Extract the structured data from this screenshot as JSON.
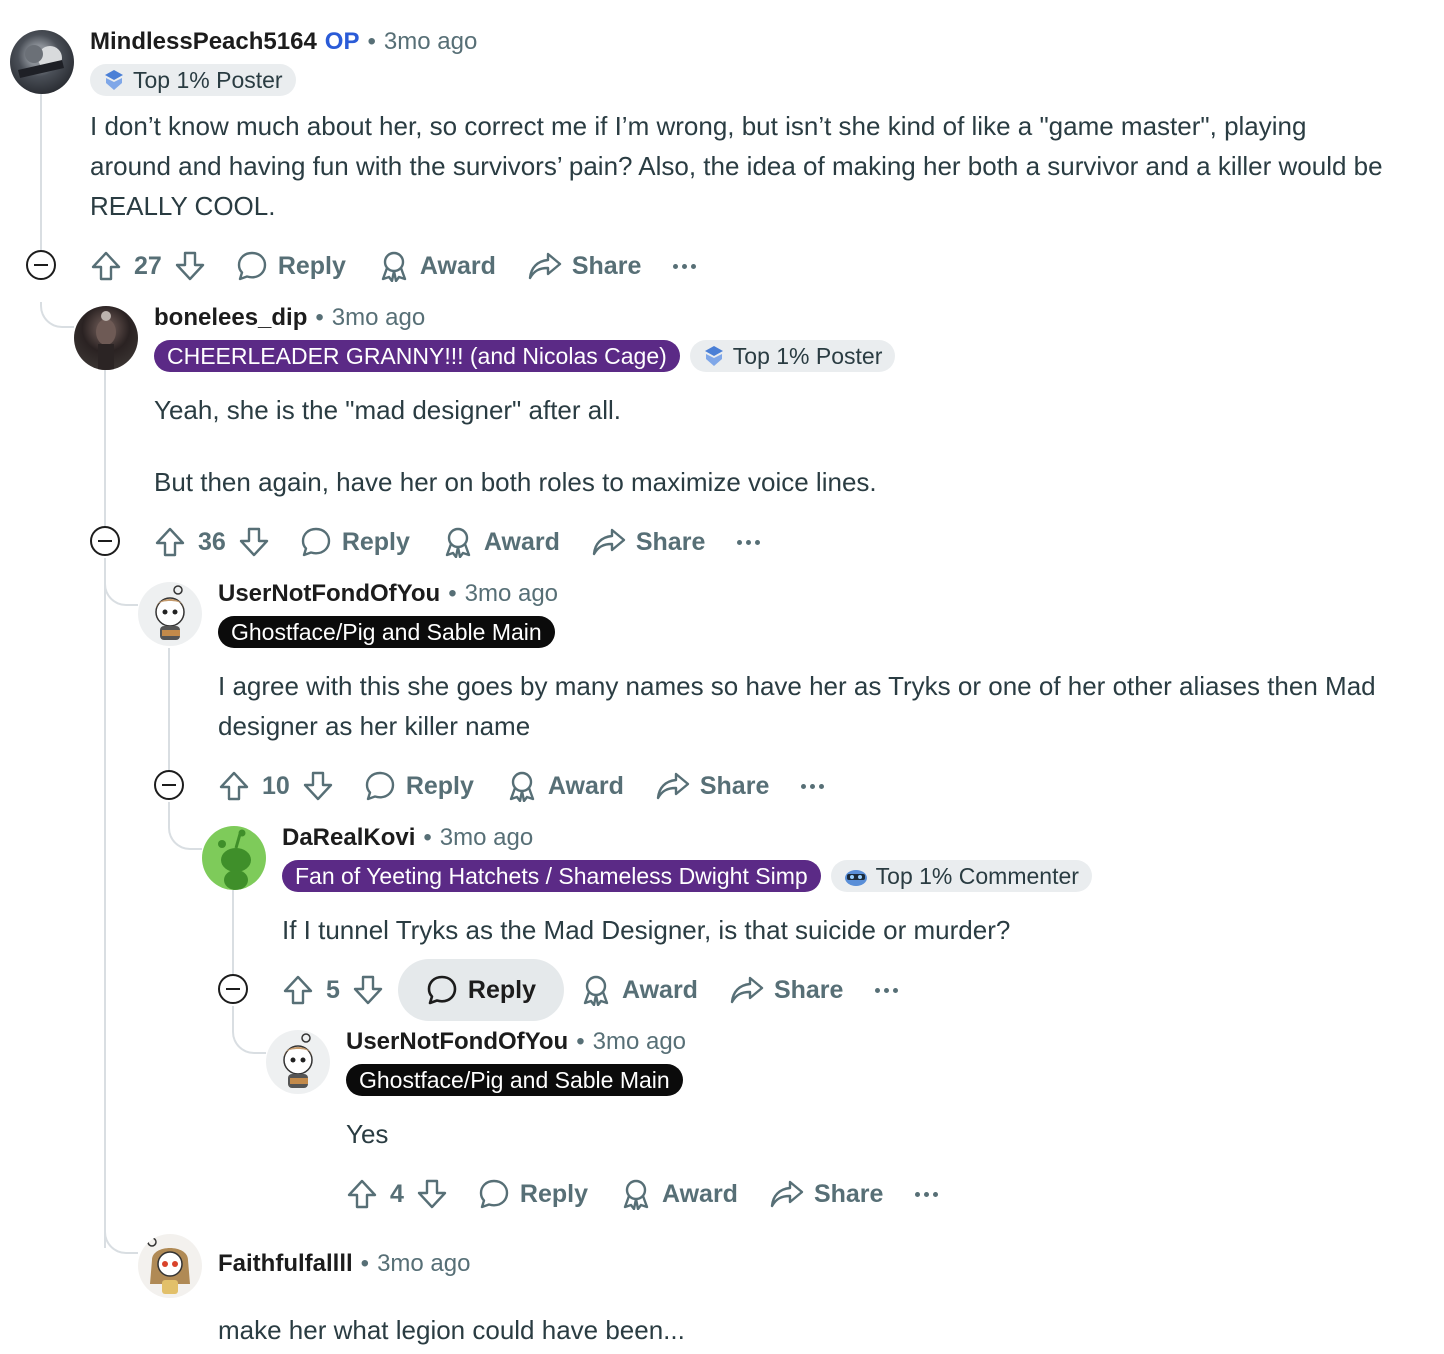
{
  "comments": [
    {
      "username": "MindlessPeach5164",
      "op_label": "OP",
      "time": "3mo ago",
      "flairs": [
        {
          "text": "Top 1% Poster",
          "icon": "top-poster-icon"
        }
      ],
      "body": [
        "I don’t know much about her, so correct me if I’m wrong, but isn’t she kind of like a \"game master\", playing around and having fun with the survivors’ pain? Also, the idea of making her both a survivor and a killer would be REALLY COOL."
      ],
      "score": "27",
      "avatar_icon": "user-avatar-icon"
    },
    {
      "username": "bonelees_dip",
      "time": "3mo ago",
      "flairs": [
        {
          "text": "CHEERLEADER GRANNY!!! (and Nicolas Cage)"
        },
        {
          "text": "Top 1% Poster",
          "icon": "top-poster-icon"
        }
      ],
      "body": [
        "Yeah, she is the \"mad designer\" after all.",
        "But then again, have her on both roles to maximize voice lines."
      ],
      "score": "36",
      "avatar_icon": "user-avatar-icon"
    },
    {
      "username": "UserNotFondOfYou",
      "time": "3mo ago",
      "flairs": [
        {
          "text": "Ghostface/Pig and Sable Main"
        }
      ],
      "body": [
        "I agree with this she goes by many names so have her as Tryks or one of her other aliases then Mad designer as her killer name"
      ],
      "score": "10",
      "avatar_icon": "snoo-avatar-icon"
    },
    {
      "username": "DaRealKovi",
      "time": "3mo ago",
      "flairs": [
        {
          "text": "Fan of Yeeting Hatchets / Shameless Dwight Simp"
        },
        {
          "text": "Top 1% Commenter",
          "icon": "top-commenter-icon"
        }
      ],
      "body": [
        "If I tunnel Tryks as the Mad Designer, is that suicide or murder?"
      ],
      "score": "5",
      "avatar_icon": "default-snoo-avatar-icon"
    },
    {
      "username": "UserNotFondOfYou",
      "time": "3mo ago",
      "flairs": [
        {
          "text": "Ghostface/Pig and Sable Main"
        }
      ],
      "body": [
        "Yes"
      ],
      "score": "4",
      "avatar_icon": "snoo-avatar-icon"
    },
    {
      "username": "Faithfulfallll",
      "time": "3mo ago",
      "body": [
        "make her what legion could have been..."
      ],
      "avatar_icon": "snoo-avatar-icon"
    }
  ],
  "actions": {
    "reply": "Reply",
    "award": "Award",
    "share": "Share"
  },
  "separator": "•",
  "colors": {
    "op": "#2a5bd7",
    "flair_purple": "#5b2a86",
    "flair_black": "#0b0b0b",
    "flair_grey": "#eaedef",
    "thread_line": "#d9dee2",
    "meta_text": "#576f76",
    "active_button_bg": "#e5e9eb"
  }
}
